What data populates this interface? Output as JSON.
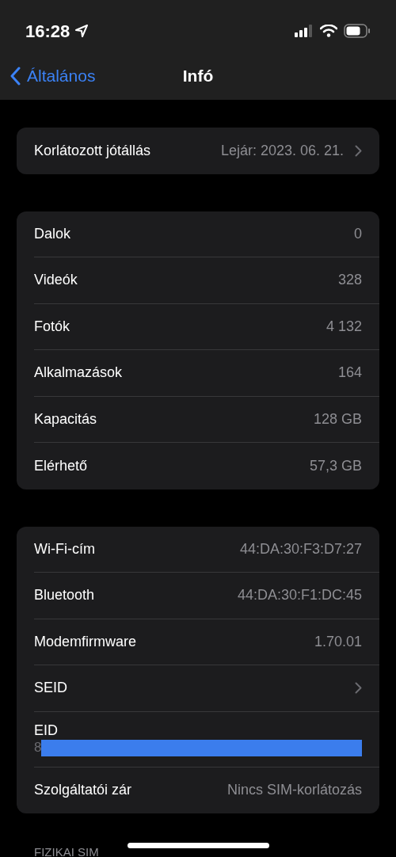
{
  "status_bar": {
    "time": "16:28"
  },
  "nav": {
    "back": "Általános",
    "title": "Infó"
  },
  "groups": [
    {
      "rows": [
        {
          "kind": "value",
          "label": "Korlátozott jótállás",
          "value": "Lejár: 2023. 06. 21.",
          "chevron": true
        }
      ]
    },
    {
      "rows": [
        {
          "kind": "value",
          "label": "Dalok",
          "value": "0",
          "chevron": false
        },
        {
          "kind": "value",
          "label": "Videók",
          "value": "328",
          "chevron": false
        },
        {
          "kind": "value",
          "label": "Fotók",
          "value": "4 132",
          "chevron": false
        },
        {
          "kind": "value",
          "label": "Alkalmazások",
          "value": "164",
          "chevron": false
        },
        {
          "kind": "value",
          "label": "Kapacitás",
          "value": "128 GB",
          "chevron": false
        },
        {
          "kind": "value",
          "label": "Elérhető",
          "value": "57,3 GB",
          "chevron": false
        }
      ]
    },
    {
      "rows": [
        {
          "kind": "value",
          "label": "Wi-Fi-cím",
          "value": "44:DA:30:F3:D7:27",
          "chevron": false
        },
        {
          "kind": "value",
          "label": "Bluetooth",
          "value": "44:DA:30:F1:DC:45",
          "chevron": false
        },
        {
          "kind": "value",
          "label": "Modemfirmware",
          "value": "1.70.01",
          "chevron": false
        },
        {
          "kind": "value",
          "label": "SEID",
          "chevron": true
        },
        {
          "kind": "redacted",
          "label": "EID",
          "value": "8"
        },
        {
          "kind": "value",
          "label": "Szolgáltatói zár",
          "value": "Nincs SIM-korlátozás",
          "chevron": false
        }
      ]
    }
  ],
  "section_header": "FIZIKAI SIM"
}
